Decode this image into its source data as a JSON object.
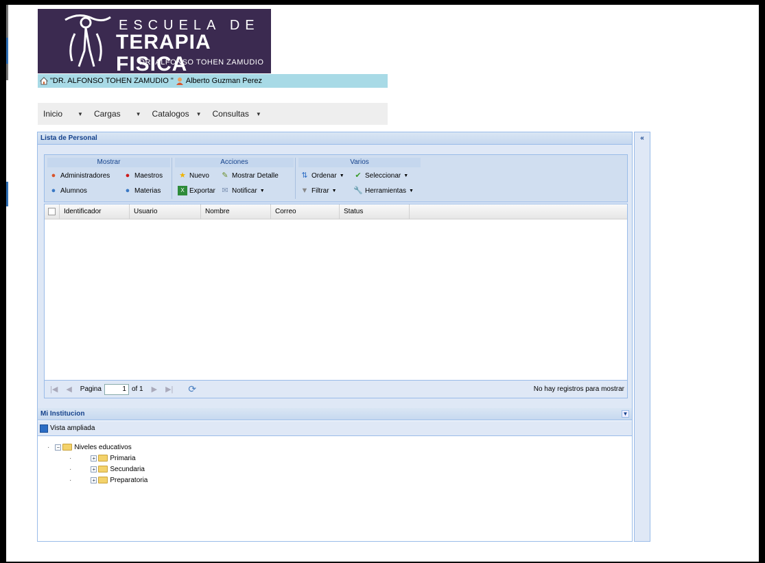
{
  "logo": {
    "line1": "ESCUELA DE",
    "line2": "TERAPIA FISICA",
    "line3": "DR. ALFONSO TOHEN ZAMUDIO"
  },
  "institution_bar": {
    "school": "\"DR. ALFONSO TOHEN ZAMUDIO \"",
    "user": "Alberto Guzman Perez"
  },
  "menu": [
    {
      "label": "Inicio"
    },
    {
      "label": "Cargas"
    },
    {
      "label": "Catalogos"
    },
    {
      "label": "Consultas"
    }
  ],
  "personal_panel": {
    "title": "Lista de Personal",
    "groups": {
      "mostrar": {
        "title": "Mostrar",
        "administradores": "Administradores",
        "maestros": "Maestros",
        "alumnos": "Alumnos",
        "materias": "Materias"
      },
      "acciones": {
        "title": "Acciones",
        "nuevo": "Nuevo",
        "mostrar_detalle": "Mostrar Detalle",
        "exportar": "Exportar",
        "notificar": "Notificar"
      },
      "varios": {
        "title": "Varios",
        "ordenar": "Ordenar",
        "seleccionar": "Seleccionar",
        "filtrar": "Filtrar",
        "herramientas": "Herramientas"
      }
    },
    "columns": [
      "Identificador",
      "Usuario",
      "Nombre",
      "Correo",
      "Status"
    ],
    "pager": {
      "page_label": "Pagina",
      "page_value": "1",
      "of_label": "of 1",
      "empty_msg": "No hay registros para mostrar"
    }
  },
  "institution_panel": {
    "title": "Mi Institucion",
    "toolbar_label": "Vista ampliada",
    "tree": {
      "root": "Niveles educativos",
      "children": [
        "Primaria",
        "Secundaria",
        "Preparatoria"
      ]
    }
  },
  "colors": {
    "logo_bg": "#3b2a50",
    "inst_bar_bg": "#a8dae6",
    "panel_header": "#15428b",
    "panel_border": "#99bbe8"
  }
}
